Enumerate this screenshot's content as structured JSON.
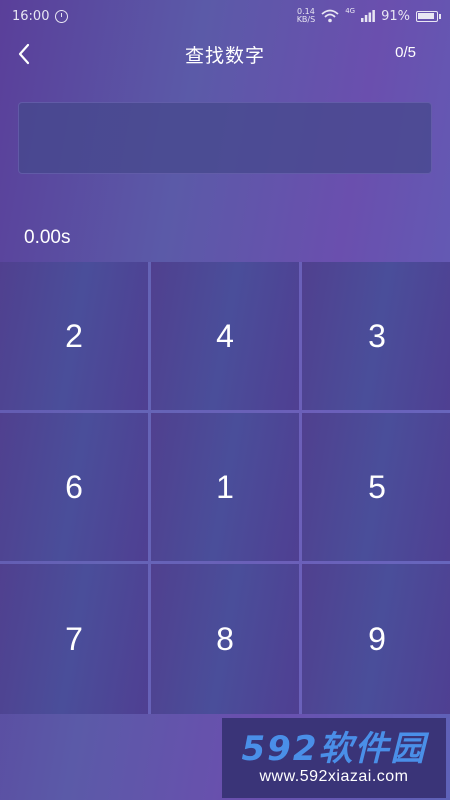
{
  "status_bar": {
    "time": "16:00",
    "net_speed_value": "0.14",
    "net_speed_unit": "KB/S",
    "network_type": "4G",
    "battery": "91%"
  },
  "header": {
    "title": "查找数字",
    "progress": "0/5"
  },
  "timer": "0.00s",
  "grid": {
    "cells": [
      "2",
      "4",
      "3",
      "6",
      "1",
      "5",
      "7",
      "8",
      "9"
    ]
  },
  "watermark": {
    "brand": "592软件园",
    "url": "www.592xiazai.com"
  }
}
